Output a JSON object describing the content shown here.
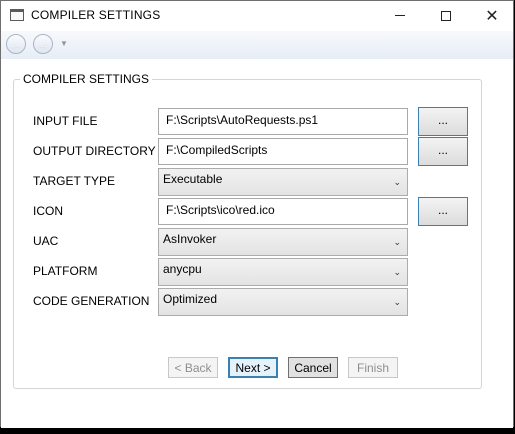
{
  "window": {
    "title": "COMPILER SETTINGS",
    "minimize_glyph": "",
    "maximize_glyph": "",
    "close_glyph": "✕"
  },
  "nav": {
    "back_glyph": "←",
    "forward_glyph": "→",
    "dropdown_glyph": "▼"
  },
  "group": {
    "title": "COMPILER SETTINGS"
  },
  "fields": {
    "input_file": {
      "label": "INPUT FILE",
      "value": "F:\\Scripts\\AutoRequests.ps1",
      "browse_label": "..."
    },
    "output_directory": {
      "label": "OUTPUT DIRECTORY",
      "value": "F:\\CompiledScripts",
      "browse_label": "..."
    },
    "target_type": {
      "label": "TARGET TYPE",
      "value": "Executable"
    },
    "icon": {
      "label": "ICON",
      "value": "F:\\Scripts\\ico\\red.ico",
      "browse_label": "..."
    },
    "uac": {
      "label": "UAC",
      "value": "AsInvoker"
    },
    "platform": {
      "label": "PLATFORM",
      "value": "anycpu"
    },
    "code_generation": {
      "label": "CODE GENERATION",
      "value": "Optimized"
    }
  },
  "combo_chevron": "⌄",
  "wizard": {
    "back_label": "< Back",
    "next_label": "Next >",
    "cancel_label": "Cancel",
    "finish_label": "Finish"
  },
  "colors": {
    "focus_border": "#3c7fb1",
    "disabled_text": "#8f8f8f"
  }
}
